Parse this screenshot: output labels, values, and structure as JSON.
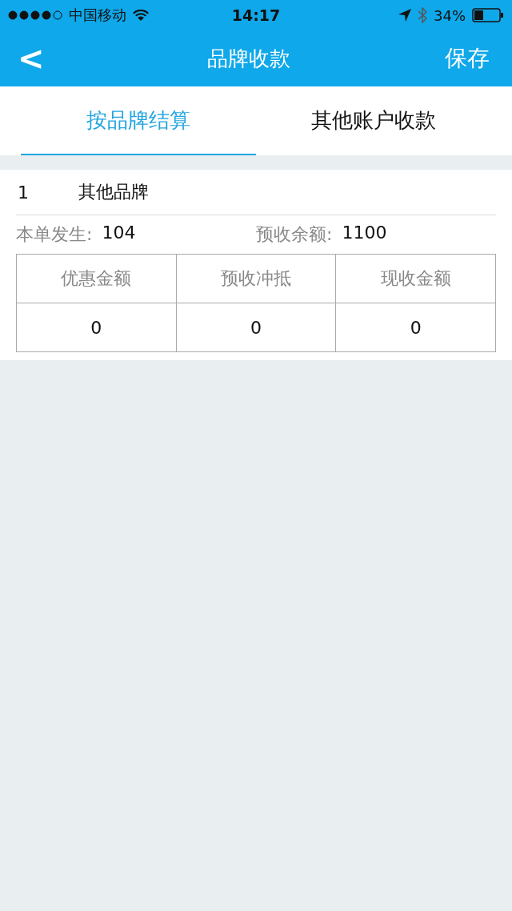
{
  "status_bar": {
    "carrier": "中国移动",
    "time": "14:17",
    "battery": "34%"
  },
  "nav": {
    "back": "<",
    "title": "品牌收款",
    "action": "保存"
  },
  "tabs": [
    {
      "label": "按品牌结算",
      "selected": true
    },
    {
      "label": "其他账户收款",
      "selected": false
    }
  ],
  "brand": {
    "index": "1",
    "name": "其他品牌",
    "summary": [
      {
        "label": "本单发生:",
        "value": "104"
      },
      {
        "label": "预收余额:",
        "value": "1100"
      }
    ],
    "table": {
      "columns": [
        "优惠金额",
        "预收冲抵",
        "现收金额"
      ],
      "rows": [
        [
          "0",
          "0",
          "0"
        ]
      ]
    }
  }
}
